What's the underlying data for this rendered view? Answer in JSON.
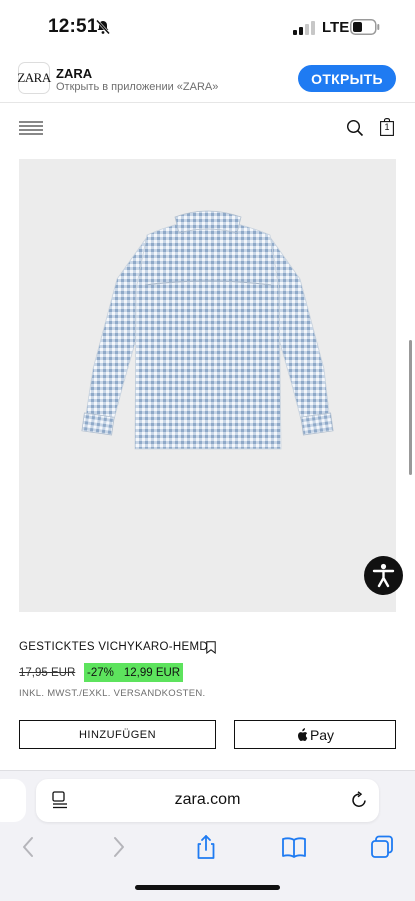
{
  "status_bar": {
    "time": "12:51",
    "network": "LTE"
  },
  "app_banner": {
    "icon_text": "ZARA",
    "name": "ZARA",
    "subtitle": "Открыть в приложении «ZARA»",
    "open_label": "ОТКРЫТЬ",
    "accent": "#1f7bf2"
  },
  "nav": {
    "bag_count": "1",
    "icons": [
      "menu-icon",
      "search-icon",
      "bag-icon"
    ]
  },
  "product": {
    "title": "GESTICKTES VICHYKARO-HEMD",
    "old_price": "17,95 EUR",
    "discount": "-27%",
    "new_price": "12,99 EUR",
    "discount_color": "#5de35d",
    "tax_note": "INKL. MWST./EXKL. VERSANDKOSTEN.",
    "add_label": "HINZUFÜGEN",
    "pay_label": "Pay"
  },
  "browser": {
    "url": "zara.com",
    "toolbar_icons": [
      "back-icon",
      "forward-icon",
      "share-icon",
      "bookmarks-icon",
      "tabs-icon"
    ]
  }
}
